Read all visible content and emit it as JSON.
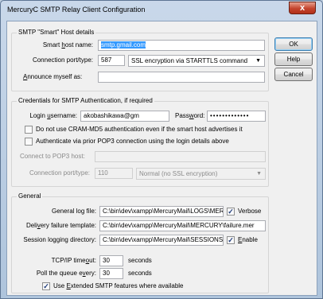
{
  "window": {
    "title": "MercuryC SMTP Relay Client Configuration",
    "close_glyph": "x"
  },
  "buttons": {
    "ok": "OK",
    "help": "Help",
    "cancel": "Cancel"
  },
  "smart_host": {
    "legend": "SMTP \"Smart\" Host details",
    "host_label": "Smart host name:",
    "host_value": "smtp.gmail.com",
    "port_label": "Connection port/type:",
    "port_value": "587",
    "encryption_value": "SSL encryption via STARTTLS command",
    "announce_label": "Announce myself as:",
    "announce_value": ""
  },
  "credentials": {
    "legend": "Credentials for SMTP Authentication, if required",
    "username_label": "Login username:",
    "username_value": "akobashikawa@gm",
    "password_label": "Password:",
    "password_value": "•••••••••••••",
    "cram_label": "Do not use CRAM-MD5 authentication even if the smart host advertises it",
    "cram_checked": false,
    "pop3_auth_label": "Authenticate via prior POP3 connection using the login details above",
    "pop3_auth_checked": false,
    "pop3_host_label": "Connect to POP3 host:",
    "pop3_host_value": "",
    "pop3_port_label": "Connection port/type:",
    "pop3_port_value": "110",
    "pop3_type_value": "Normal (no SSL encryption)"
  },
  "general": {
    "legend": "General",
    "log_label": "General log file:",
    "log_value": "C:\\bin\\dev\\xampp\\MercuryMail\\LOGS\\MER",
    "verbose_label": "Verbose",
    "verbose_checked": true,
    "failure_label": "Delivery failure template:",
    "failure_value": "C:\\bin\\dev\\xampp\\MercuryMail\\MERCURY\\failure.mer",
    "session_label": "Session logging directory:",
    "session_value": "C:\\bin\\dev\\xampp\\MercuryMail\\SESSIONS\\",
    "enable_label": "Enable",
    "enable_checked": true,
    "timeout_label": "TCP/IP timeout:",
    "timeout_value": "30",
    "timeout_unit": "seconds",
    "poll_label": "Poll the queue every:",
    "poll_value": "30",
    "poll_unit": "seconds",
    "extended_label": "Use Extended SMTP features where available",
    "extended_checked": true
  },
  "colors": {
    "selection": "#3399ff",
    "close_button": "#c4432d",
    "title_gradient": "#c9d8ea"
  }
}
